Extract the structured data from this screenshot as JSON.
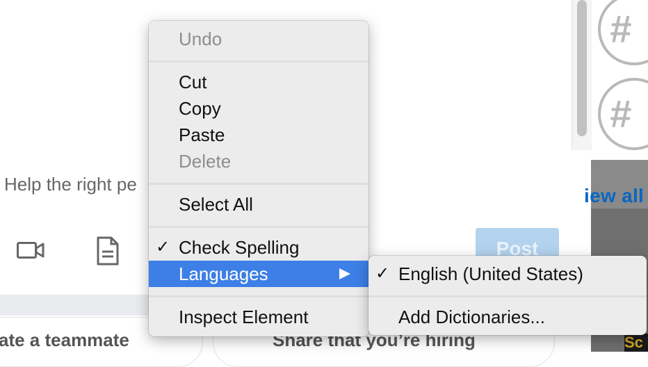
{
  "background": {
    "help_text": "Help the right pe",
    "view_all": "iew all",
    "post_button": "Post",
    "bottom_left": "ate a teammate",
    "bottom_right": "Share that you’re hiring",
    "hash_symbol": "#",
    "corner_logo": "Sc",
    "colors": {
      "link": "#0a66c2",
      "post_disabled_bg": "#b3d2ee"
    }
  },
  "context_menu": {
    "items": [
      {
        "label": "Undo",
        "enabled": false
      },
      {
        "label": "Cut",
        "enabled": true
      },
      {
        "label": "Copy",
        "enabled": true
      },
      {
        "label": "Paste",
        "enabled": true
      },
      {
        "label": "Delete",
        "enabled": false
      },
      {
        "label": "Select All",
        "enabled": true
      },
      {
        "label": "Check Spelling",
        "enabled": true,
        "checked": true
      },
      {
        "label": "Languages",
        "enabled": true,
        "highlighted": true,
        "has_submenu": true
      },
      {
        "label": "Inspect Element",
        "enabled": true
      }
    ],
    "check_mark": "✓",
    "highlight_color": "#3d7fe6"
  },
  "submenu": {
    "items": [
      {
        "label": "English (United States)",
        "checked": true
      },
      {
        "label": "Add Dictionaries..."
      }
    ]
  }
}
